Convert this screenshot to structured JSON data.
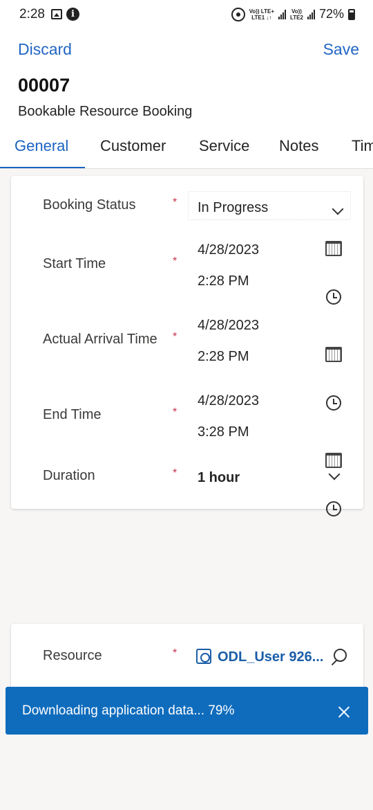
{
  "status_bar": {
    "time": "2:28",
    "network_1": "Vo)) LTE+",
    "network_1_sub": "LTE1 ↓↑",
    "network_2": "Vo))",
    "network_2_sub": "LTE2",
    "battery": "72%"
  },
  "header": {
    "discard_label": "Discard",
    "save_label": "Save",
    "record_id": "00007",
    "entity_name": "Bookable Resource Booking"
  },
  "tabs": [
    {
      "label": "General"
    },
    {
      "label": "Customer"
    },
    {
      "label": "Service"
    },
    {
      "label": "Notes"
    },
    {
      "label": "Tim"
    }
  ],
  "form": {
    "booking_status": {
      "label": "Booking Status",
      "required": "*",
      "value": "In Progress"
    },
    "start_time": {
      "label": "Start Time",
      "required": "*",
      "date": "4/28/2023",
      "time": "2:28 PM"
    },
    "actual_arrival_time": {
      "label": "Actual Arrival Time",
      "required": "*",
      "date": "4/28/2023",
      "time": "2:28 PM"
    },
    "end_time": {
      "label": "End Time",
      "required": "*",
      "date": "4/28/2023",
      "time": "3:28 PM"
    },
    "duration": {
      "label": "Duration",
      "required": "*",
      "value": "1 hour"
    },
    "resource": {
      "label": "Resource",
      "required": "*",
      "value": "ODL_User 926..."
    }
  },
  "toast": {
    "message": "Downloading application data... 79%"
  },
  "colors": {
    "accent": "#1b63c2",
    "required": "#c4314b",
    "toast_bg": "#0f6cbd"
  }
}
